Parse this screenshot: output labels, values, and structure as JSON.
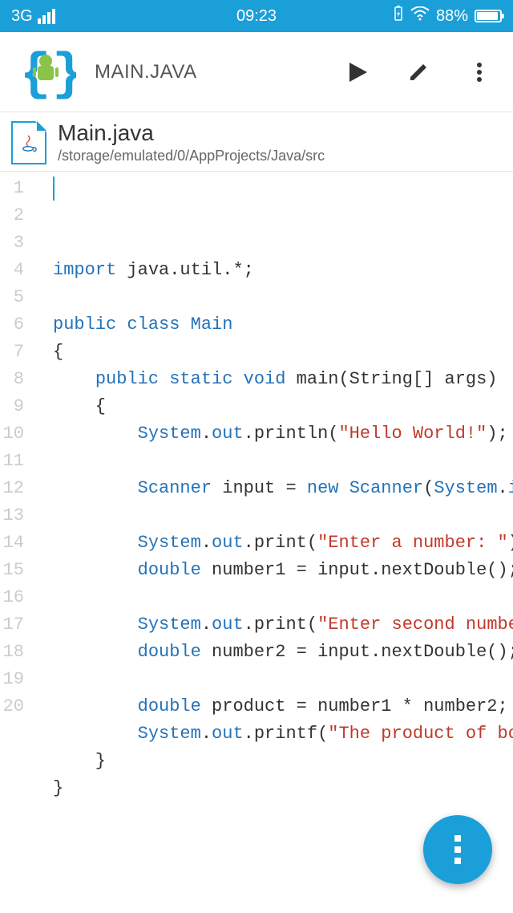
{
  "status_bar": {
    "network": "3G",
    "time": "09:23",
    "battery_pct": "88%"
  },
  "app_bar": {
    "title": "MAIN.JAVA"
  },
  "file": {
    "name": "Main.java",
    "path": "/storage/emulated/0/AppProjects/Java/src"
  },
  "code": {
    "line_count": 20,
    "lines": [
      {
        "n": 1,
        "tokens": [
          {
            "t": "import ",
            "c": "kw"
          },
          {
            "t": "java.util.*;",
            "c": "txt"
          }
        ]
      },
      {
        "n": 2,
        "tokens": []
      },
      {
        "n": 3,
        "tokens": [
          {
            "t": "public class ",
            "c": "kw"
          },
          {
            "t": "Main",
            "c": "cls"
          }
        ]
      },
      {
        "n": 4,
        "tokens": [
          {
            "t": "{",
            "c": "txt"
          }
        ]
      },
      {
        "n": 5,
        "tokens": [
          {
            "t": "    ",
            "c": "txt"
          },
          {
            "t": "public static ",
            "c": "kw"
          },
          {
            "t": "void ",
            "c": "vtype"
          },
          {
            "t": "main(String[] args)",
            "c": "txt"
          }
        ]
      },
      {
        "n": 6,
        "tokens": [
          {
            "t": "    {",
            "c": "txt"
          }
        ]
      },
      {
        "n": 7,
        "tokens": [
          {
            "t": "        ",
            "c": "txt"
          },
          {
            "t": "System",
            "c": "cls"
          },
          {
            "t": ".",
            "c": "txt"
          },
          {
            "t": "out",
            "c": "fld"
          },
          {
            "t": ".println(",
            "c": "txt"
          },
          {
            "t": "\"Hello World!\"",
            "c": "str"
          },
          {
            "t": ");",
            "c": "txt"
          }
        ]
      },
      {
        "n": 8,
        "tokens": []
      },
      {
        "n": 9,
        "tokens": [
          {
            "t": "        ",
            "c": "txt"
          },
          {
            "t": "Scanner ",
            "c": "cls"
          },
          {
            "t": "input = ",
            "c": "txt"
          },
          {
            "t": "new ",
            "c": "kw"
          },
          {
            "t": "Scanner",
            "c": "cls"
          },
          {
            "t": "(",
            "c": "txt"
          },
          {
            "t": "System",
            "c": "cls"
          },
          {
            "t": ".",
            "c": "txt"
          },
          {
            "t": "in",
            "c": "fld"
          },
          {
            "t": ");",
            "c": "txt"
          }
        ]
      },
      {
        "n": 10,
        "tokens": []
      },
      {
        "n": 11,
        "tokens": [
          {
            "t": "        ",
            "c": "txt"
          },
          {
            "t": "System",
            "c": "cls"
          },
          {
            "t": ".",
            "c": "txt"
          },
          {
            "t": "out",
            "c": "fld"
          },
          {
            "t": ".print(",
            "c": "txt"
          },
          {
            "t": "\"Enter a number: \"",
            "c": "str"
          },
          {
            "t": ");",
            "c": "txt"
          }
        ]
      },
      {
        "n": 12,
        "tokens": [
          {
            "t": "        ",
            "c": "txt"
          },
          {
            "t": "double ",
            "c": "vtype"
          },
          {
            "t": "number1 = input.nextDouble();",
            "c": "txt"
          }
        ]
      },
      {
        "n": 13,
        "tokens": []
      },
      {
        "n": 14,
        "tokens": [
          {
            "t": "        ",
            "c": "txt"
          },
          {
            "t": "System",
            "c": "cls"
          },
          {
            "t": ".",
            "c": "txt"
          },
          {
            "t": "out",
            "c": "fld"
          },
          {
            "t": ".print(",
            "c": "txt"
          },
          {
            "t": "\"Enter second number: \"",
            "c": "str"
          },
          {
            "t": ");",
            "c": "txt"
          }
        ]
      },
      {
        "n": 15,
        "tokens": [
          {
            "t": "        ",
            "c": "txt"
          },
          {
            "t": "double ",
            "c": "vtype"
          },
          {
            "t": "number2 = input.nextDouble();",
            "c": "txt"
          }
        ]
      },
      {
        "n": 16,
        "tokens": []
      },
      {
        "n": 17,
        "tokens": [
          {
            "t": "        ",
            "c": "txt"
          },
          {
            "t": "double ",
            "c": "vtype"
          },
          {
            "t": "product = number1 * number2;",
            "c": "txt"
          }
        ]
      },
      {
        "n": 18,
        "tokens": [
          {
            "t": "        ",
            "c": "txt"
          },
          {
            "t": "System",
            "c": "cls"
          },
          {
            "t": ".",
            "c": "txt"
          },
          {
            "t": "out",
            "c": "fld"
          },
          {
            "t": ".printf(",
            "c": "txt"
          },
          {
            "t": "\"The product of both numbers",
            "c": "str"
          }
        ]
      },
      {
        "n": 19,
        "tokens": [
          {
            "t": "    }",
            "c": "txt"
          }
        ]
      },
      {
        "n": 20,
        "tokens": [
          {
            "t": "}",
            "c": "txt"
          }
        ]
      }
    ]
  }
}
